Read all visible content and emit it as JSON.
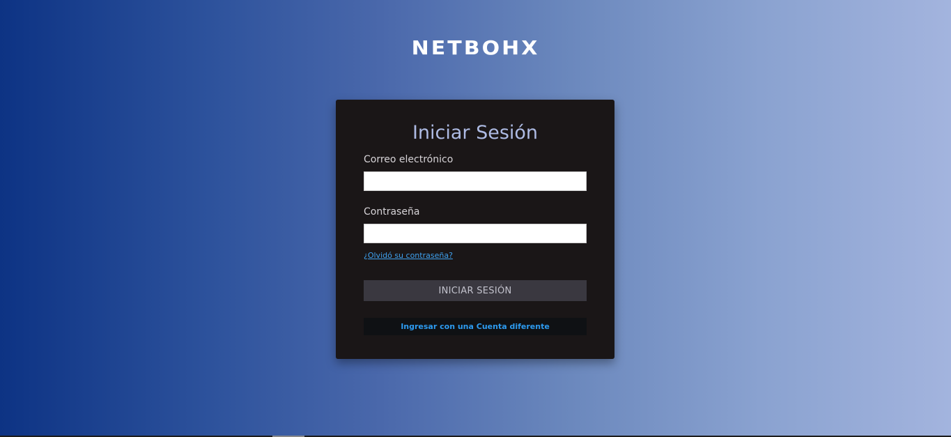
{
  "brand": {
    "logo_text": "NETBOHX"
  },
  "login": {
    "title": "Iniciar Sesión",
    "email_label": "Correo electrónico",
    "email_value": "",
    "password_label": "Contraseña",
    "password_value": "",
    "forgot_link": "¿Olvidó su contraseña?",
    "submit_label": "INICIAR SESIÓN",
    "other_account_label": "Ingresar con una Cuenta diferente"
  },
  "colors": {
    "background_gradient_start": "#0d3384",
    "background_gradient_end": "#a3b4de",
    "card_background": "#1a1617",
    "title_color": "#aebbe4",
    "link_color": "#3fa2f0",
    "submit_button_bg": "#3a3840",
    "other_button_bg": "#0f1114",
    "other_button_text": "#2d9bf0"
  }
}
